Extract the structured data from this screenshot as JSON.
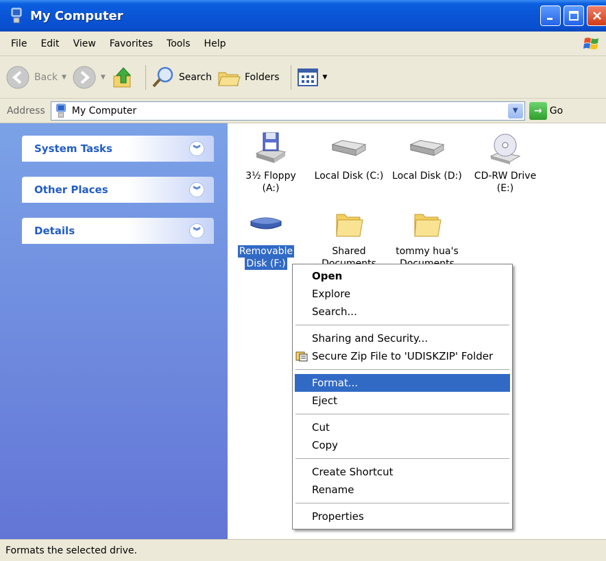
{
  "window": {
    "title": "My Computer"
  },
  "menu": [
    "File",
    "Edit",
    "View",
    "Favorites",
    "Tools",
    "Help"
  ],
  "toolbar": {
    "back": "Back",
    "search": "Search",
    "folders": "Folders"
  },
  "address": {
    "label": "Address",
    "value": "My Computer",
    "go": "Go"
  },
  "left_panel": [
    {
      "title": "System Tasks"
    },
    {
      "title": "Other Places"
    },
    {
      "title": "Details"
    }
  ],
  "drives": [
    {
      "line1": "3½ Floppy",
      "line2": "(A:)",
      "icon": "floppy-drive-icon"
    },
    {
      "line1": "Local Disk (C:)",
      "line2": "",
      "icon": "hard-disk-icon"
    },
    {
      "line1": "Local Disk (D:)",
      "line2": "",
      "icon": "hard-disk-icon"
    },
    {
      "line1": "CD-RW Drive",
      "line2": "(E:)",
      "icon": "cd-drive-icon"
    },
    {
      "line1": "Removable",
      "line2": "Disk (F:)",
      "icon": "removable-disk-icon"
    },
    {
      "line1": "Shared",
      "line2": "Documents",
      "icon": "folder-icon"
    },
    {
      "line1": "tommy hua's",
      "line2": "Documents",
      "icon": "folder-icon"
    }
  ],
  "context_menu": {
    "open": "Open",
    "explore": "Explore",
    "search": "Search...",
    "sharing": "Sharing and Security...",
    "securezip": "Secure Zip File to 'UDISKZIP' Folder",
    "format": "Format...",
    "eject": "Eject",
    "cut": "Cut",
    "copy": "Copy",
    "create_shortcut": "Create Shortcut",
    "rename": "Rename",
    "properties": "Properties"
  },
  "status": "Formats the selected drive.",
  "colors": {
    "title_blue": "#0a55d6",
    "selection": "#316ac5",
    "panel_text": "#215dc6"
  }
}
